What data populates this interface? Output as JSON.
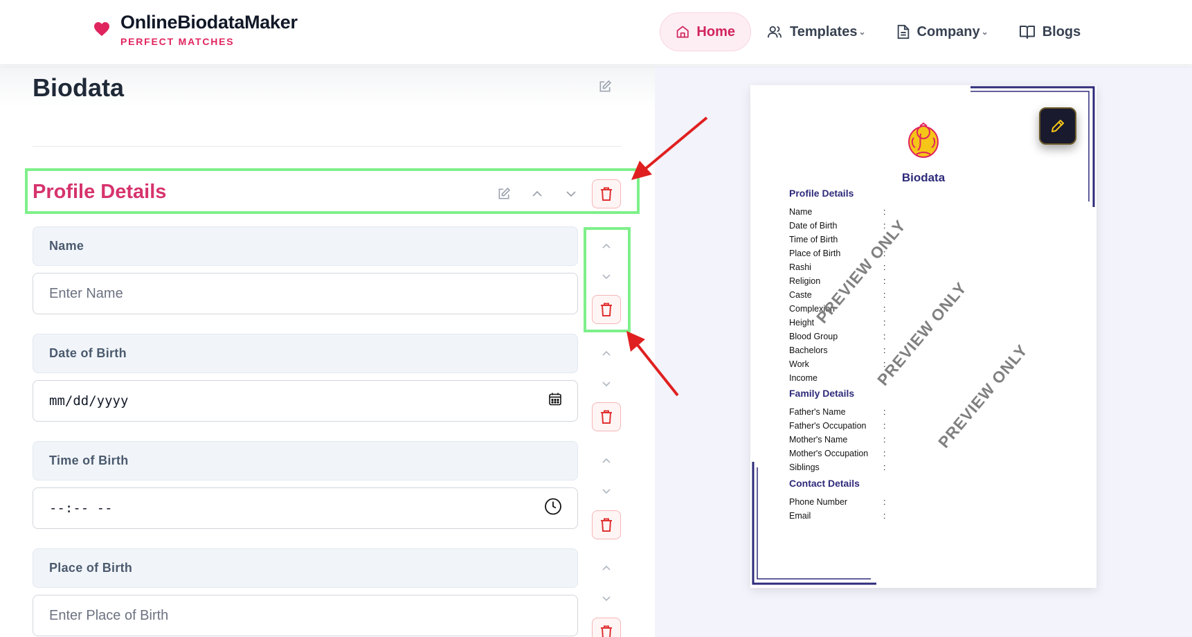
{
  "brand": {
    "title": "OnlineBiodataMaker",
    "subtitle": "PERFECT MATCHES",
    "accent": "#e0245e"
  },
  "nav": {
    "home": "Home",
    "templates": "Templates",
    "company": "Company",
    "blogs": "Blogs"
  },
  "editor": {
    "page_title": "Biodata",
    "section_title": "Profile Details",
    "fields": [
      {
        "label": "Name",
        "input": "Enter Name"
      },
      {
        "label": "Date of Birth",
        "input": "mm/dd/yyyy"
      },
      {
        "label": "Time of Birth",
        "input": "--:-- --"
      },
      {
        "label": "Place of Birth",
        "input": "Enter Place of Birth"
      }
    ]
  },
  "preview": {
    "title": "Biodata",
    "watermark": "PREVIEW ONLY",
    "separator": ":",
    "sections": [
      {
        "title": "Profile Details",
        "rows": [
          "Name",
          "Date of Birth",
          "Time of Birth",
          "Place of Birth",
          "Rashi",
          "Religion",
          "Caste",
          "Complexion",
          "Height",
          "Blood Group",
          "Bachelors",
          "Work",
          "Income"
        ]
      },
      {
        "title": "Family Details",
        "rows": [
          "Father's Name",
          "Father's Occupation",
          "Mother's Name",
          "Mother's Occupation",
          "Siblings"
        ]
      },
      {
        "title": "Contact Details",
        "rows": [
          "Phone Number",
          "Email"
        ]
      }
    ]
  },
  "colors": {
    "section_title": "#d6336c",
    "highlight_box": "#7ef08a",
    "annotation_arrow": "#e02020",
    "preview_heading": "#2e2a7a"
  }
}
